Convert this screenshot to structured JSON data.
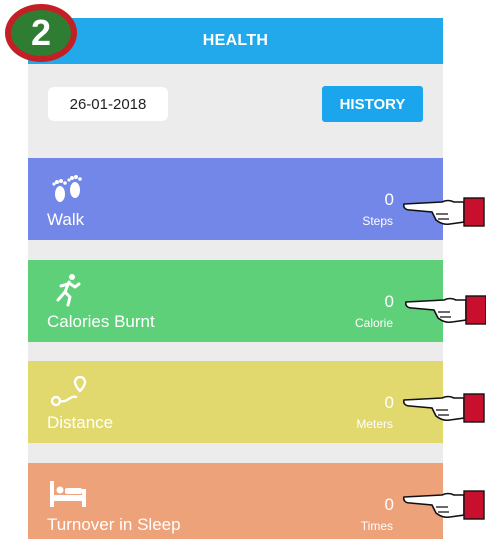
{
  "badge": {
    "number": "2"
  },
  "header": {
    "title": "HEALTH"
  },
  "date": "26-01-2018",
  "history_label": "HISTORY",
  "colors": {
    "header": "#22a9ec",
    "walk": "#7287e7",
    "calories": "#5ed07a",
    "distance": "#e1d86e",
    "sleep": "#eea27a",
    "badge_ring": "#c41f25",
    "badge_fill": "#2e7d32",
    "cuff": "#c8102e"
  },
  "cards": [
    {
      "label": "Walk",
      "value": "0",
      "unit": "Steps",
      "icon": "footprints-icon"
    },
    {
      "label": "Calories Burnt",
      "value": "0",
      "unit": "Calorie",
      "icon": "running-person-icon"
    },
    {
      "label": "Distance",
      "value": "0",
      "unit": "Meters",
      "icon": "route-pin-icon"
    },
    {
      "label": "Turnover in Sleep",
      "value": "0",
      "unit": "Times",
      "icon": "bed-icon"
    }
  ]
}
